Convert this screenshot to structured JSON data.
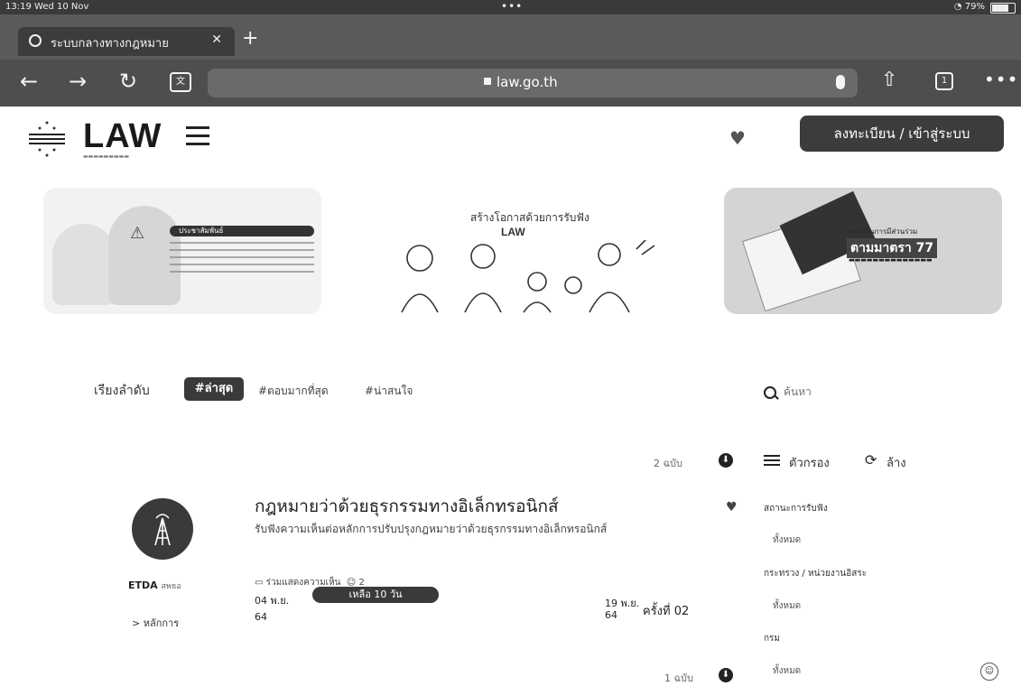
{
  "status_bar": {
    "time": "13:19",
    "date": "Wed 10 Nov",
    "battery": "79%"
  },
  "browser": {
    "tab_title": "ระบบกลางทางกฎหมาย",
    "url": "law.go.th"
  },
  "site": {
    "logo": "LAW",
    "register_button": "ลงทะเบียน / เข้าสู่ระบบ"
  },
  "banners": {
    "b1_heading": "ประชาสัมพันธ์",
    "b2_title": "สร้างโอกาสด้วยการรับฟัง",
    "b2_logo": "LAW",
    "b3_line1": "กระบวนการมีส่วนร่วม",
    "b3_line2": "ตามมาตรา 77"
  },
  "sort": {
    "label": "เรียงลำดับ",
    "options": [
      "#ล่าสุด",
      "#ตอบมากที่สุด",
      "#น่าสนใจ"
    ]
  },
  "search": {
    "placeholder": "ค้นหา"
  },
  "list": {
    "count_top": "2 ฉบับ",
    "count_bottom": "1 ฉบับ"
  },
  "card": {
    "org": "ETDA",
    "org_sub": "สพธอ",
    "principle_link": "> หลักการ",
    "title": "กฎหมายว่าด้วยธุรกรรมทางอิเล็กทรอนิกส์",
    "description": "รับฟังความเห็นต่อหลักการปรับปรุงกฎหมายว่าด้วยธุรกรรมทางอิเล็กทรอนิกส์",
    "meta_label": "ร่วมแสดงความเห็น",
    "comments": "2",
    "start_date": "04 พ.ย.",
    "start_year": "64",
    "remaining": "เหลือ 10 วัน",
    "end_date": "19 พ.ย.",
    "end_year": "64",
    "round": "ครั้งที่ 02"
  },
  "filters": {
    "label": "ตัวกรอง",
    "clear": "ล้าง",
    "groups": [
      {
        "label": "สถานะการรับฟัง",
        "value": "ทั้งหมด"
      },
      {
        "label": "กระทรวง / หน่วยงานอิสระ",
        "value": "ทั้งหมด"
      },
      {
        "label": "กรม",
        "value": "ทั้งหมด"
      }
    ]
  },
  "colors": {
    "accent": "#3a3a3a",
    "page_bg": "#ffffff"
  }
}
